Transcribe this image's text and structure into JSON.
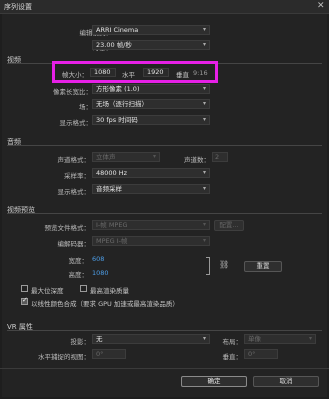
{
  "window": {
    "title": "序列设置",
    "close": "✕"
  },
  "top": {
    "editing_mode_label": "编辑模式：",
    "editing_mode_value": "ARRI Cinema",
    "timebase_label": "时基：",
    "timebase_value": "23.00 帧/秒"
  },
  "video": {
    "section": "视频",
    "frame_size_label": "帧大小：",
    "width": "1080",
    "horizontal_label": "水平",
    "height": "1920",
    "vertical_label": "垂直",
    "aspect": "9:16",
    "pixel_aspect_label": "像素长宽比：",
    "pixel_aspect_value": "方形像素 (1.0)",
    "fields_label": "场：",
    "fields_value": "无场（逐行扫描）",
    "display_format_label": "显示格式：",
    "display_format_value": "30 fps 时间码"
  },
  "audio": {
    "section": "音频",
    "channel_format_label": "声道格式：",
    "channel_format_value": "立体声",
    "channels_label": "声道数：",
    "channels_value": "2",
    "sample_rate_label": "采样率：",
    "sample_rate_value": "48000 Hz",
    "display_format_label": "显示格式：",
    "display_format_value": "音频采样"
  },
  "preview": {
    "section": "视频预览",
    "file_format_label": "预览文件格式：",
    "file_format_value": "I-帧 MPEG",
    "config_button": "配置...",
    "codec_label": "编解码器：",
    "codec_value": "MPEG I-帧",
    "width_label": "宽度：",
    "width_value": "608",
    "height_label": "高度：",
    "height_value": "1080",
    "reset_button": "重置",
    "max_depth_label": "最大位深度",
    "max_quality_label": "最高渲染质量",
    "linear_color_label": "以线性颜色合成（要求 GPU 加速或最高渲染品质）"
  },
  "vr": {
    "section": "VR 属性",
    "projection_label": "投影：",
    "projection_value": "无",
    "layout_label": "布局：",
    "layout_value": "单像",
    "horizontal_view_label": "水平捕捉的视图：",
    "horizontal_view_value": "0°",
    "vertical_label": "垂直：",
    "vertical_value": "0°"
  },
  "footer": {
    "ok": "确定",
    "cancel": "取消"
  },
  "highlight_color": "#e620e6"
}
